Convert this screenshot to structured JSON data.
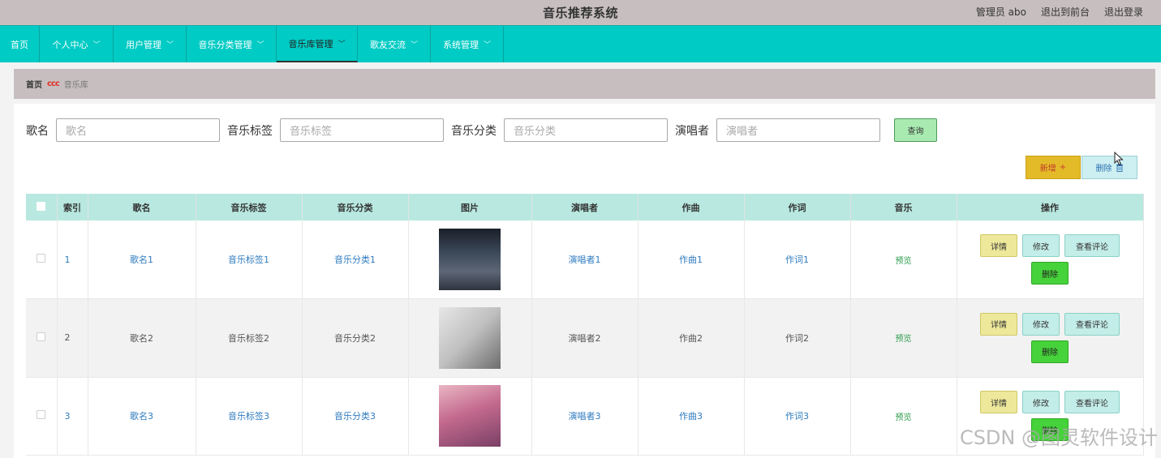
{
  "header": {
    "title": "音乐推荐系统",
    "admin": "管理员 abo",
    "to_front": "退出到前台",
    "logout": "退出登录"
  },
  "nav": [
    {
      "label": "首页",
      "chevron": false,
      "active": false
    },
    {
      "label": "个人中心",
      "chevron": true,
      "active": false
    },
    {
      "label": "用户管理",
      "chevron": true,
      "active": false
    },
    {
      "label": "音乐分类管理",
      "chevron": true,
      "active": false
    },
    {
      "label": "音乐库管理",
      "chevron": true,
      "active": true
    },
    {
      "label": "歌友交流",
      "chevron": true,
      "active": false
    },
    {
      "label": "系统管理",
      "chevron": true,
      "active": false
    }
  ],
  "breadcrumb": {
    "home": "首页",
    "separator": "ccc",
    "current": "音乐库"
  },
  "search": {
    "fields": [
      {
        "label": "歌名",
        "placeholder": "歌名"
      },
      {
        "label": "音乐标签",
        "placeholder": "音乐标签"
      },
      {
        "label": "音乐分类",
        "placeholder": "音乐分类"
      },
      {
        "label": "演唱者",
        "placeholder": "演唱者"
      }
    ],
    "button": "查询"
  },
  "actions": {
    "add": "新增",
    "add_icon": "+",
    "delete": "删除",
    "delete_icon": "trash-icon"
  },
  "table": {
    "columns": [
      "索引",
      "歌名",
      "音乐标签",
      "音乐分类",
      "图片",
      "演唱者",
      "作曲",
      "作词",
      "音乐",
      "操作"
    ],
    "rows": [
      {
        "index": "1",
        "name": "歌名1",
        "tag": "音乐标签1",
        "category": "音乐分类1",
        "singer": "演唱者1",
        "composer": "作曲1",
        "lyricist": "作词1",
        "music": "预览"
      },
      {
        "index": "2",
        "name": "歌名2",
        "tag": "音乐标签2",
        "category": "音乐分类2",
        "singer": "演唱者2",
        "composer": "作曲2",
        "lyricist": "作词2",
        "music": "预览"
      },
      {
        "index": "3",
        "name": "歌名3",
        "tag": "音乐标签3",
        "category": "音乐分类3",
        "singer": "演唱者3",
        "composer": "作曲3",
        "lyricist": "作词3",
        "music": "预览"
      }
    ],
    "ops": {
      "detail": "详情",
      "edit": "修改",
      "comment": "查看评论",
      "delete": "删除"
    }
  },
  "watermark": "CSDN @图灵软件设计"
}
